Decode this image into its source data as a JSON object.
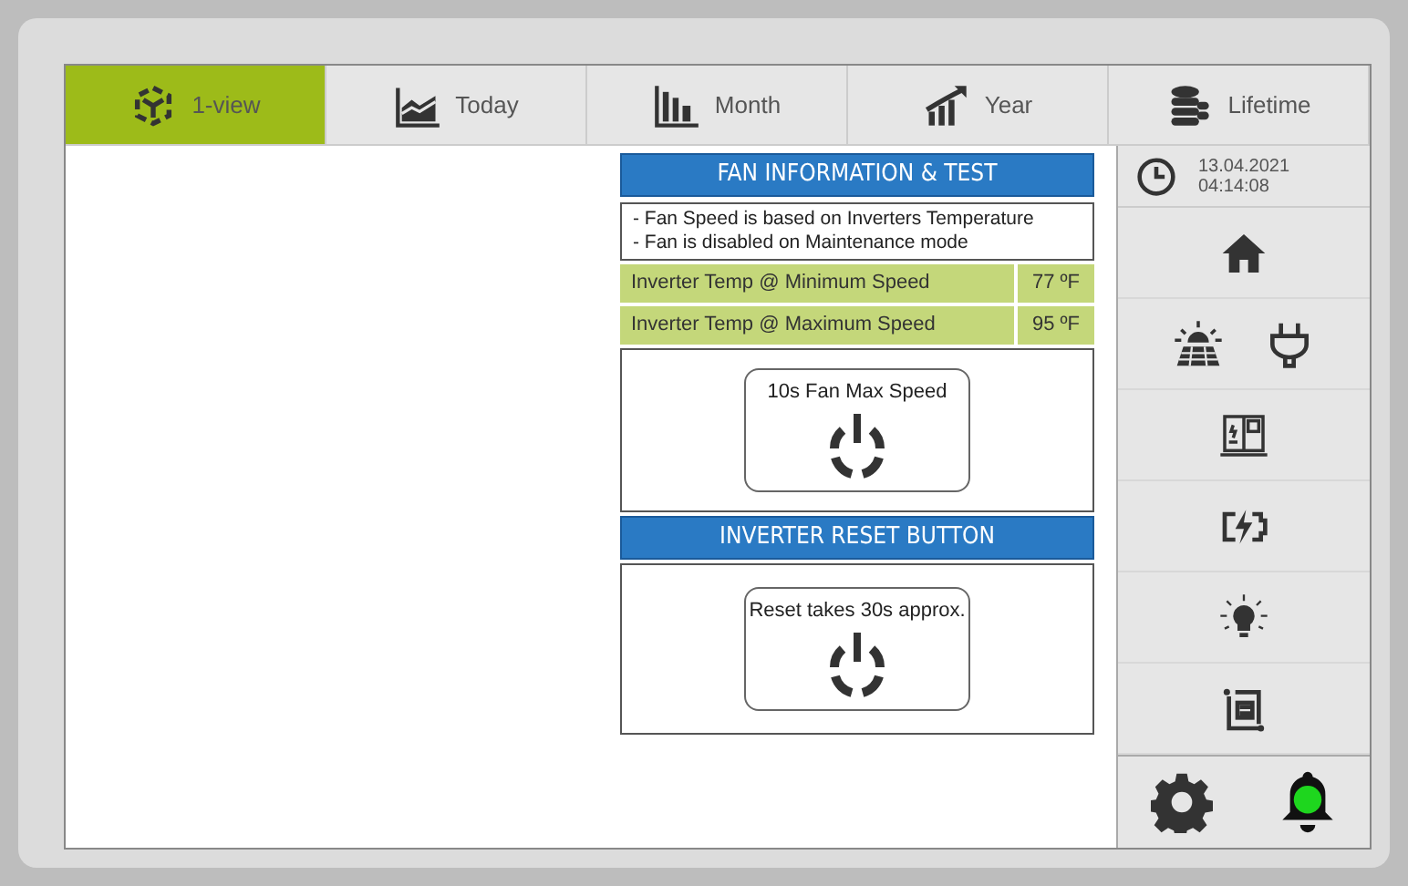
{
  "tabs": [
    {
      "label": "1-view",
      "selected": true
    },
    {
      "label": "Today",
      "selected": false
    },
    {
      "label": "Month",
      "selected": false
    },
    {
      "label": "Year",
      "selected": false
    },
    {
      "label": "Lifetime",
      "selected": false
    }
  ],
  "clock": {
    "date": "13.04.2021",
    "time": "04:14:08"
  },
  "alarm": {
    "on": true
  },
  "fan": {
    "title": "FAN INFORMATION & TEST",
    "notes": [
      "- Fan Speed is based on Inverters Temperature",
      "- Fan is disabled on Maintenance mode"
    ],
    "rows": [
      {
        "label": "Inverter Temp @ Minimum Speed",
        "value": "77 ºF"
      },
      {
        "label": "Inverter Temp @ Maximum Speed",
        "value": "95 ºF"
      }
    ],
    "button": "10s Fan Max Speed"
  },
  "reset": {
    "title": "INVERTER RESET BUTTON",
    "button": "Reset takes 30s approx."
  }
}
